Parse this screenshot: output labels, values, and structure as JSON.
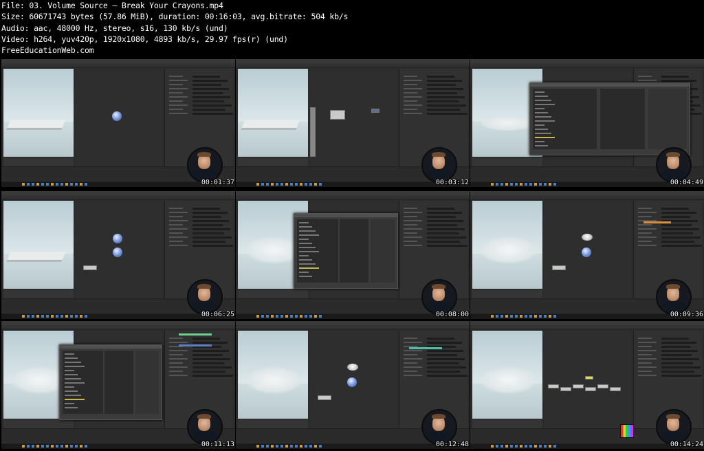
{
  "header": {
    "file": "File: 03. Volume Source – Break Your Crayons.mp4",
    "size": "Size: 60671743 bytes (57.86 MiB), duration: 00:16:03, avg.bitrate: 504 kb/s",
    "audio": "Audio: aac, 48000 Hz, stereo, s16, 130 kb/s (und)",
    "video": "Video: h264, yuv420p, 1920x1080, 4893 kb/s, 29.97 fps(r) (und)",
    "site": "FreeEducationWeb.com"
  },
  "thumbnails": [
    {
      "timestamp": "00:01:37",
      "scene": "box"
    },
    {
      "timestamp": "00:03:12",
      "scene": "box-nodes"
    },
    {
      "timestamp": "00:04:49",
      "scene": "disc-dialog"
    },
    {
      "timestamp": "00:06:25",
      "scene": "box-graph"
    },
    {
      "timestamp": "00:08:00",
      "scene": "cloud-dialog"
    },
    {
      "timestamp": "00:09:36",
      "scene": "cloud-graph"
    },
    {
      "timestamp": "00:11:13",
      "scene": "cloud-dialog-2"
    },
    {
      "timestamp": "00:12:48",
      "scene": "cloud-graph-2"
    },
    {
      "timestamp": "00:14:24",
      "scene": "cloud-network"
    }
  ],
  "colors": {
    "background": "#000000",
    "text": "#ffffff",
    "app_dark": "#2b2b2b"
  }
}
